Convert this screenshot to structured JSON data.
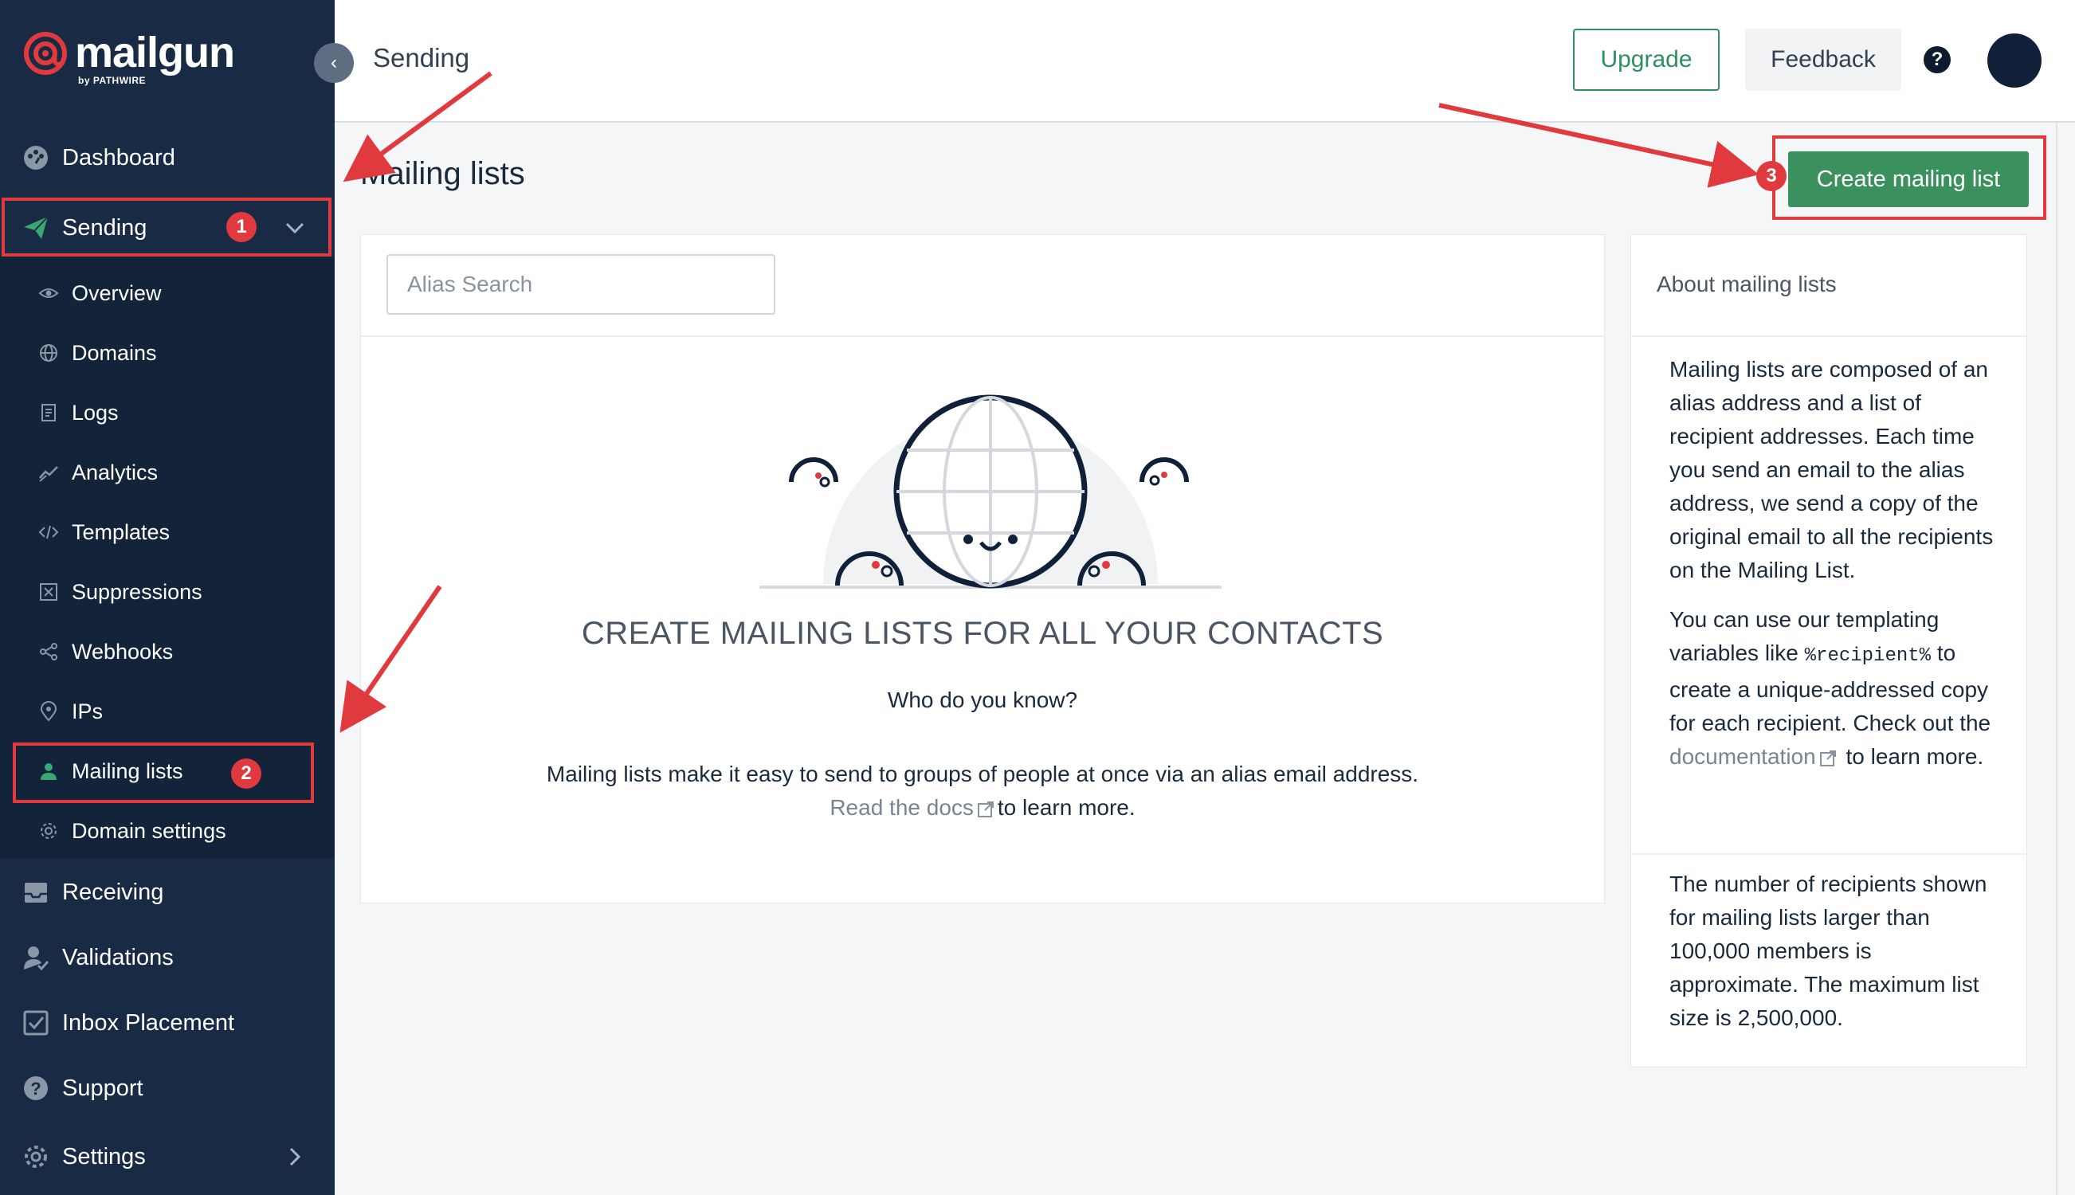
{
  "brand": {
    "name": "mailgun",
    "sub": "by PATHWIRE"
  },
  "header": {
    "breadcrumb": "Sending",
    "upgrade_label": "Upgrade",
    "feedback_label": "Feedback",
    "help_label": "?"
  },
  "sidebar": {
    "items": [
      {
        "label": "Dashboard",
        "icon": "dashboard-icon"
      },
      {
        "label": "Sending",
        "icon": "paper-plane-icon",
        "badge": "1"
      },
      {
        "label": "Receiving",
        "icon": "inbox-icon"
      },
      {
        "label": "Validations",
        "icon": "user-check-icon"
      },
      {
        "label": "Inbox Placement",
        "icon": "checkbox-icon"
      },
      {
        "label": "Support",
        "icon": "question-icon"
      },
      {
        "label": "Settings",
        "icon": "gear-icon"
      }
    ],
    "sub_items": [
      {
        "label": "Overview",
        "icon": "eye-icon"
      },
      {
        "label": "Domains",
        "icon": "globe-icon"
      },
      {
        "label": "Logs",
        "icon": "document-icon"
      },
      {
        "label": "Analytics",
        "icon": "chart-icon"
      },
      {
        "label": "Templates",
        "icon": "code-icon"
      },
      {
        "label": "Suppressions",
        "icon": "x-box-icon"
      },
      {
        "label": "Webhooks",
        "icon": "share-icon"
      },
      {
        "label": "IPs",
        "icon": "pin-icon"
      },
      {
        "label": "Mailing lists",
        "icon": "person-icon",
        "badge": "2"
      },
      {
        "label": "Domain settings",
        "icon": "gear-small-icon"
      }
    ]
  },
  "main": {
    "title": "Mailing lists",
    "create_label": "Create mailing list",
    "create_badge": "3",
    "search": {
      "placeholder": "Alias Search",
      "value": ""
    },
    "empty": {
      "title": "CREATE MAILING LISTS FOR ALL YOUR CONTACTS",
      "subtitle": "Who do you know?",
      "description": "Mailing lists make it easy to send to groups of people at once via an alias email address.",
      "docs_link": "Read the docs",
      "docs_suffix": "to learn more."
    }
  },
  "aside": {
    "title": "About mailing lists",
    "para1": "Mailing lists are composed of an alias address and a list of recipient addresses. Each time you send an email to the alias address, we send a copy of the original email to all the recipients on the Mailing List.",
    "para2_a": "You can use our templating variables like",
    "para2_code": "%recipient%",
    "para2_b": "to create a unique-addressed copy for each recipient. Check out the",
    "para2_link": "documentation",
    "para2_c": "to learn more.",
    "para3": "The number of recipients shown for mailing lists larger than 100,000 members is approximate. The maximum list size is 2,500,000."
  },
  "colors": {
    "sidebar": "#182a44",
    "accent_green": "#3a915e",
    "annotation_red": "#e03a3e",
    "brand_red": "#e03a3e"
  }
}
